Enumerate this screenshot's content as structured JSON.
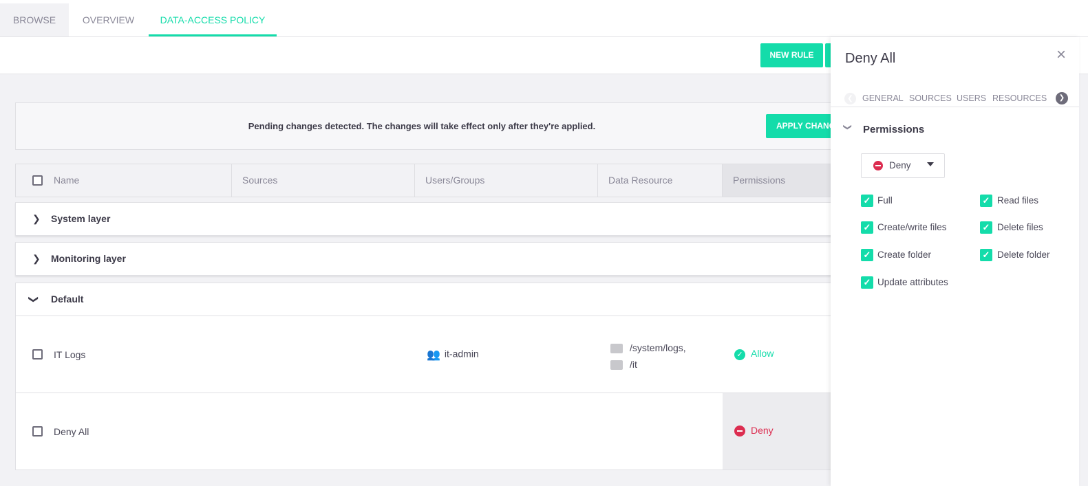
{
  "tabs": [
    {
      "label": "BROWSE"
    },
    {
      "label": "OVERVIEW"
    },
    {
      "label": "DATA-ACCESS POLICY"
    }
  ],
  "toolbar": {
    "new_rule": "NEW RULE"
  },
  "banner": {
    "message": "Pending changes detected. The changes will take effect only after they're applied.",
    "apply": "APPLY CHANGES"
  },
  "table": {
    "columns": [
      "Name",
      "Sources",
      "Users/Groups",
      "Data Resource",
      "Permissions"
    ],
    "groups": [
      {
        "label": "System layer",
        "expanded": false
      },
      {
        "label": "Monitoring layer",
        "expanded": false
      },
      {
        "label": "Default",
        "expanded": true
      }
    ],
    "rows": [
      {
        "name": "IT Logs",
        "users": "it-admin",
        "resources": [
          "/system/logs,",
          "/it"
        ],
        "permission": "Allow"
      },
      {
        "name": "Deny All",
        "users": "",
        "resources": [],
        "permission": "Deny"
      }
    ]
  },
  "panel": {
    "title": "Deny All",
    "tabs": [
      "GENERAL",
      "SOURCES",
      "USERS",
      "RESOURCES"
    ],
    "section": "Permissions",
    "mode": "Deny",
    "permissions": [
      {
        "label": "Full",
        "checked": true
      },
      {
        "label": "Read files",
        "checked": true
      },
      {
        "label": "Create/write files",
        "checked": true
      },
      {
        "label": "Delete files",
        "checked": true
      },
      {
        "label": "Create folder",
        "checked": true
      },
      {
        "label": "Delete folder",
        "checked": true
      },
      {
        "label": "Update attributes",
        "checked": true
      }
    ]
  },
  "colors": {
    "accent": "#14dcaa",
    "deny": "#dc2d50"
  }
}
